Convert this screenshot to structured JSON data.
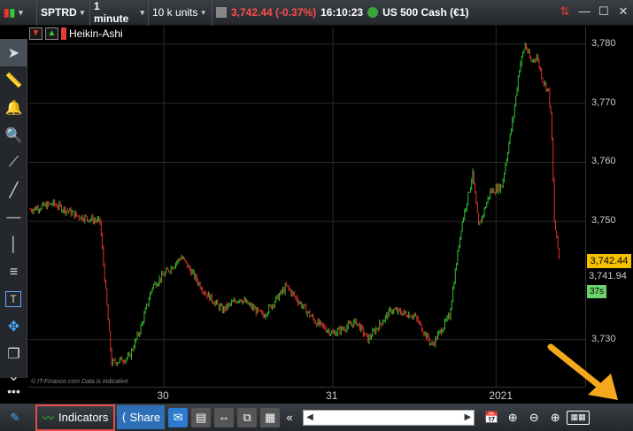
{
  "topbar": {
    "symbol": "SPTRD",
    "timeframe": "1 minute",
    "size": "10 k units",
    "price": "3,742.44 (-0.37%)",
    "time": "16:10:23",
    "instrument": "US 500 Cash (€1)"
  },
  "chart_header": {
    "title": "Heikin-Ashi"
  },
  "chart_data": {
    "type": "line",
    "title": "Heikin-Ashi",
    "xlabel": "",
    "ylabel": "",
    "y_ticks": [
      "3,780",
      "3,770",
      "3,760",
      "3,750",
      "3,730"
    ],
    "x_ticks": [
      "30",
      "31",
      "2021"
    ],
    "ylim": [
      3722,
      3783
    ],
    "x": [
      0,
      4,
      8,
      12,
      14,
      17,
      19,
      21,
      24,
      26,
      28,
      30,
      33,
      36,
      40,
      44,
      49,
      52,
      56,
      58,
      62,
      66,
      69,
      72,
      74,
      76,
      77,
      79,
      81,
      83,
      84,
      85,
      86,
      87,
      88,
      89,
      89.5,
      90,
      91
    ],
    "close": [
      3752,
      3753,
      3751,
      3750,
      3726,
      3727,
      3732,
      3739,
      3742,
      3744,
      3741,
      3738,
      3735,
      3737,
      3734,
      3739,
      3733,
      3731,
      3733,
      3730,
      3735,
      3734,
      3729,
      3734,
      3749,
      3758,
      3749,
      3755,
      3756,
      3768,
      3776,
      3780,
      3777,
      3778,
      3774,
      3772,
      3767,
      3750,
      3742.4
    ],
    "last_price": "3,742.44",
    "secondary_price": "3,741.94",
    "timer": "37s",
    "colors": {
      "up": "#2fbf2f",
      "down": "#e23030"
    }
  },
  "watermark": "© IT-Finance.com  Data is indicative",
  "bottombar": {
    "indicators_label": "Indicators",
    "share_label": "Share"
  }
}
